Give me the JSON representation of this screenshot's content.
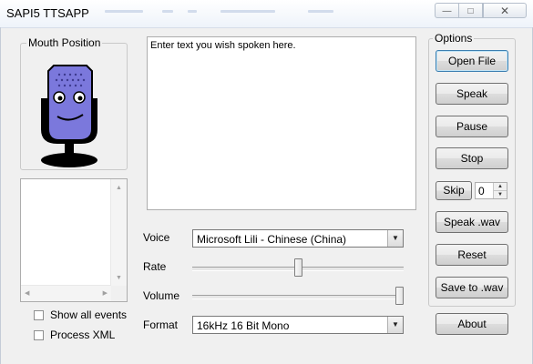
{
  "window": {
    "title": "SAPI5 TTSAPP",
    "minimize_glyph": "—",
    "maximize_glyph": "□",
    "close_glyph": "✕"
  },
  "mouth_position": {
    "title": "Mouth Position",
    "avatar_icon": "talking-microphone-character-icon",
    "colors": {
      "head": "#7b78dc",
      "dark": "#000000",
      "eye": "#ffffff"
    }
  },
  "events_list": {
    "scroll_up": "▲",
    "scroll_down": "▼",
    "scroll_left": "◀",
    "scroll_right": "▶"
  },
  "checkboxes": {
    "show_all_events": {
      "label": "Show all events",
      "checked": false
    },
    "process_xml": {
      "label": "Process XML",
      "checked": false
    }
  },
  "text_input": {
    "value": "Enter text you wish spoken here."
  },
  "voice": {
    "label": "Voice",
    "selected": "Microsoft Lili - Chinese (China)",
    "dropdown_glyph": "▼"
  },
  "rate": {
    "label": "Rate",
    "level": 0.5
  },
  "volume": {
    "label": "Volume",
    "level": 1.0
  },
  "format": {
    "label": "Format",
    "selected": "16kHz 16 Bit Mono",
    "dropdown_glyph": "▼"
  },
  "options": {
    "title": "Options",
    "open_file": "Open File",
    "speak": "Speak",
    "pause": "Pause",
    "stop": "Stop",
    "skip": "Skip",
    "skip_count": "0",
    "spin_up": "▲",
    "spin_down": "▼",
    "speak_wav": "Speak .wav",
    "reset": "Reset",
    "save_to_wav": "Save to .wav",
    "about": "About"
  }
}
